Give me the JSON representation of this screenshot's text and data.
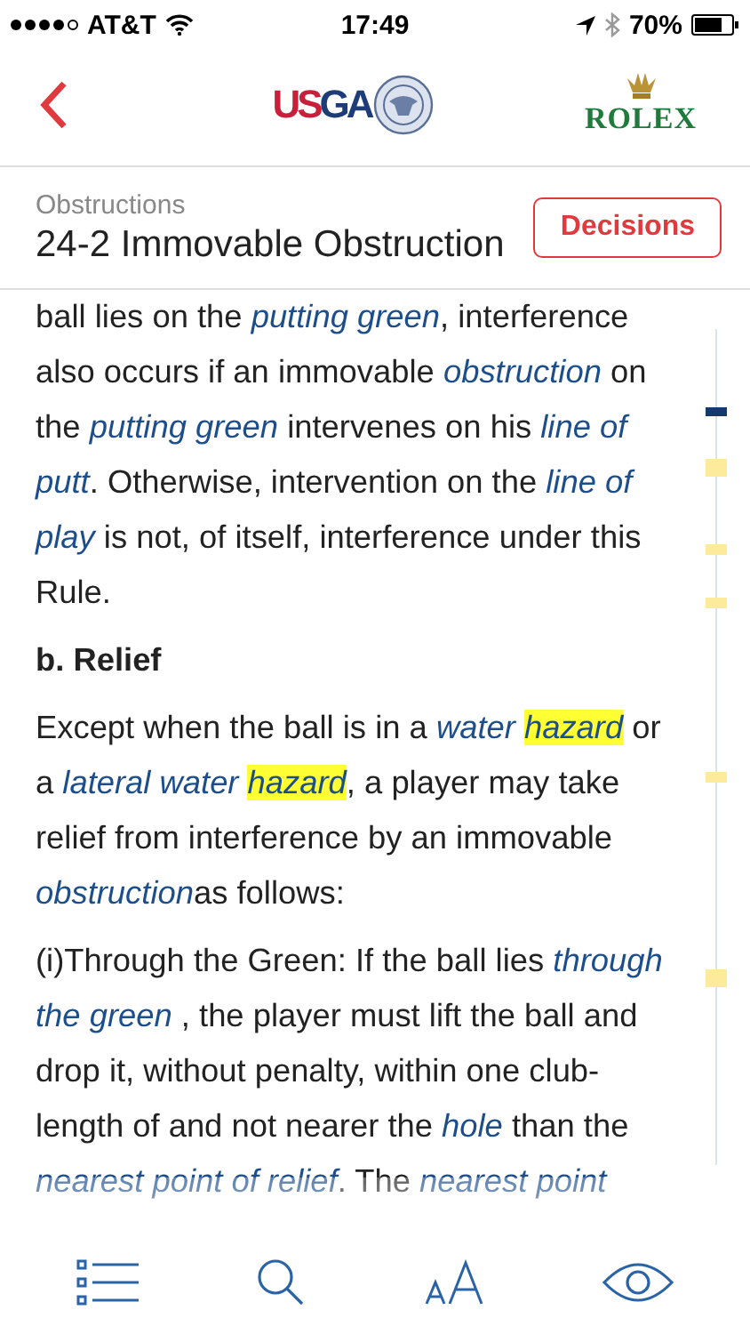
{
  "status_bar": {
    "carrier": "AT&T",
    "time": "17:49",
    "battery": "70%"
  },
  "nav": {
    "usga_logo": [
      {
        "text": "US",
        "kind": "red"
      },
      {
        "text": "GA",
        "kind": "navy"
      }
    ],
    "rolex_logo": "ROLEX"
  },
  "header": {
    "section": "Obstructions",
    "title": "24-2 Immovable Obstruction",
    "button": "Decisions"
  },
  "content": [
    {
      "kind": "paragraph",
      "segments": [
        {
          "kind": "text",
          "text": "ball lies on the "
        },
        {
          "kind": "term",
          "text": "putting green",
          "highlighted": false
        },
        {
          "kind": "text",
          "text": ", interference also occurs if an immovable "
        },
        {
          "kind": "term",
          "text": "obstruction",
          "highlighted": false
        },
        {
          "kind": "text",
          "text": " on the "
        },
        {
          "kind": "term",
          "text": "putting green",
          "highlighted": false
        },
        {
          "kind": "text",
          "text": " intervenes on his "
        },
        {
          "kind": "term",
          "text": "line of putt",
          "highlighted": false
        },
        {
          "kind": "text",
          "text": ". Otherwise, intervention on the "
        },
        {
          "kind": "term",
          "text": "line of play",
          "highlighted": false
        },
        {
          "kind": "text",
          "text": " is not, of itself, interference under this Rule."
        }
      ]
    },
    {
      "kind": "heading",
      "segments": [
        {
          "kind": "text",
          "text": "b. Relief"
        }
      ]
    },
    {
      "kind": "paragraph",
      "segments": [
        {
          "kind": "text",
          "text": "Except when the ball is in a "
        },
        {
          "kind": "term",
          "text": "water ",
          "highlighted": false
        },
        {
          "kind": "term",
          "text": "hazard",
          "highlighted": true
        },
        {
          "kind": "text",
          "text": " or a "
        },
        {
          "kind": "term",
          "text": "lateral water ",
          "highlighted": false
        },
        {
          "kind": "term",
          "text": "hazard",
          "highlighted": true
        },
        {
          "kind": "text",
          "text": ", a player may take relief from interference by an immovable "
        },
        {
          "kind": "term",
          "text": "obstruction",
          "highlighted": false
        },
        {
          "kind": "text",
          "text": "as follows:"
        }
      ]
    },
    {
      "kind": "paragraph",
      "segments": [
        {
          "kind": "text",
          "text": "(i)Through the Green: If the ball lies "
        },
        {
          "kind": "term",
          "text": "through the green",
          "highlighted": false
        },
        {
          "kind": "text",
          "text": " , the player must lift the ball and drop it, without penalty, within one club-length of and not nearer the "
        },
        {
          "kind": "term",
          "text": "hole",
          "highlighted": false
        },
        {
          "kind": "text",
          "text": " than the "
        },
        {
          "kind": "term",
          "text": "nearest point of relief",
          "highlighted": false
        },
        {
          "kind": "text",
          "text": ". The "
        },
        {
          "kind": "term",
          "text": "nearest point",
          "highlighted": false
        }
      ]
    }
  ]
}
